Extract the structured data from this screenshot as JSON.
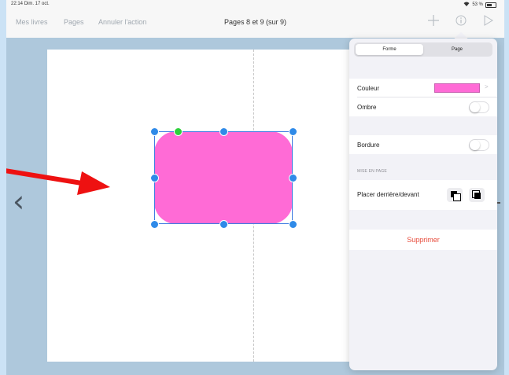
{
  "status_bar": {
    "time": "22:14",
    "date": "Dim. 17 oct.",
    "battery": "53 %"
  },
  "toolbar": {
    "my_books": "Mes livres",
    "pages": "Pages",
    "undo": "Annuler l'action",
    "title": "Pages 8 et 9 (sur 9)",
    "icons": [
      "plus-icon",
      "info-icon",
      "play-icon"
    ]
  },
  "canvas": {
    "nav_prev_glyph": "‹",
    "shape_color": "#ff6bd6",
    "selection_color": "#3d7be0",
    "arrow_color": "#ee1111"
  },
  "popover": {
    "tabs": [
      {
        "label": "Forme",
        "active": true
      },
      {
        "label": "Page",
        "active": false
      }
    ],
    "color_label": "Couleur",
    "color_value": "#ff6bd6",
    "shadow_label": "Ombre",
    "shadow_on": false,
    "border_label": "Bordure",
    "border_on": false,
    "layout_header": "MISE EN PAGE",
    "order_label": "Placer derrière/devant",
    "delete_label": "Supprimer",
    "delete_color": "#e74c3c"
  }
}
